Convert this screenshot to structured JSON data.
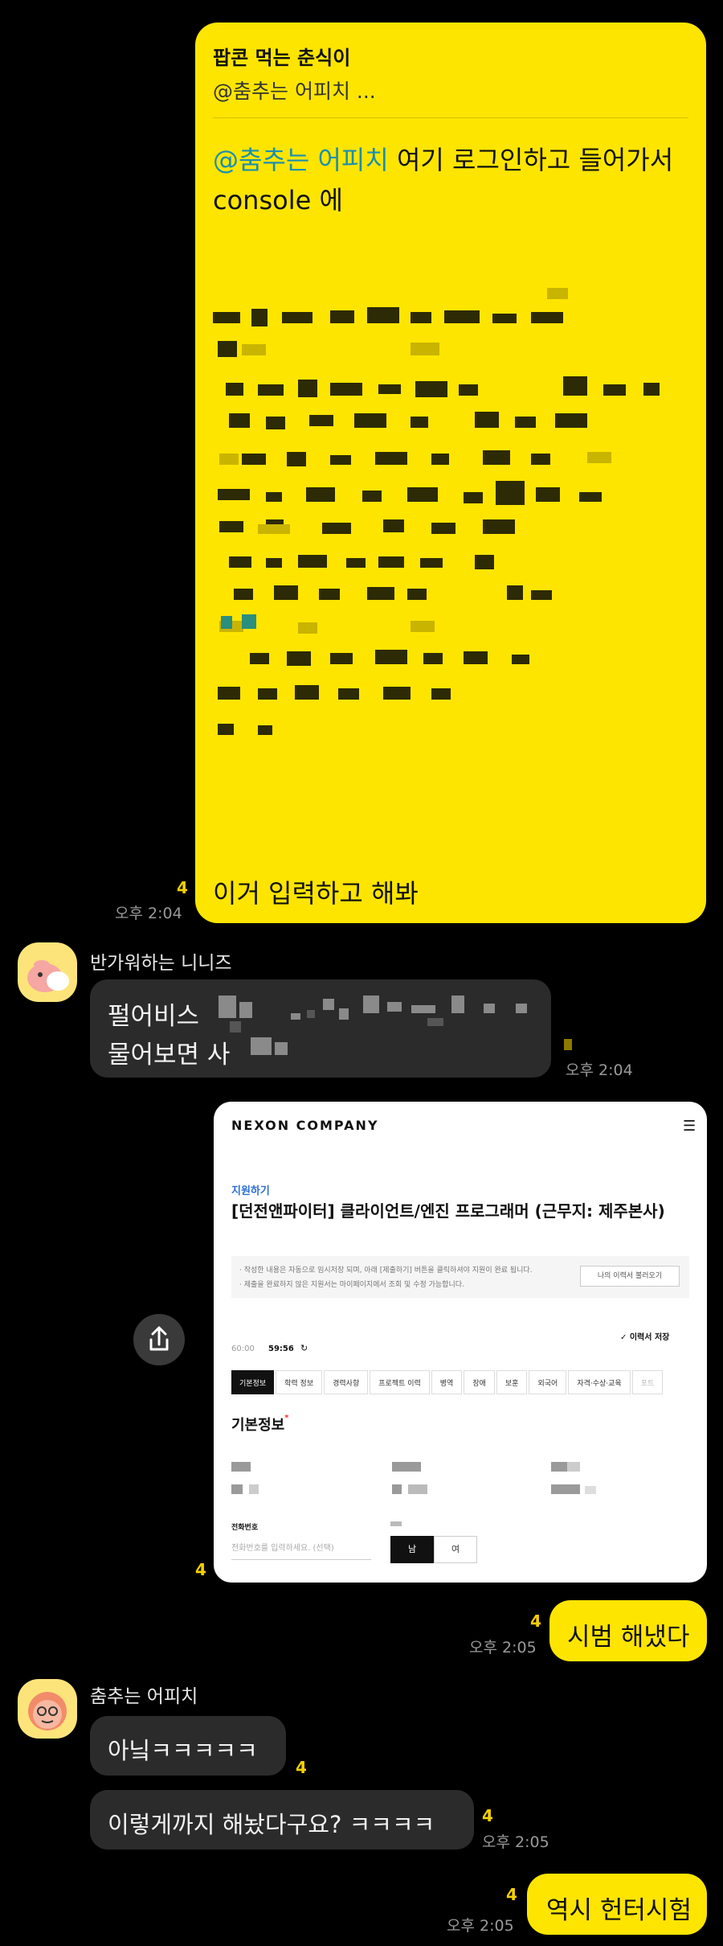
{
  "msg1": {
    "reply_name": "팝콘 먹는 춘식이",
    "reply_text": "@춤추는 어피치 ...",
    "mention": "@춤추는 어피치",
    "line1_rest": " 여기 로그인하고 들어가서",
    "line2": "console 에",
    "footer": "이거 입력하고 해봐",
    "count": "4",
    "time": "오후 2:04"
  },
  "msg2": {
    "sender": "반가워하는 니니즈",
    "line1": "펄어비스",
    "line2": "물어보면 사",
    "time": "오후 2:04"
  },
  "msg3": {
    "count": "4",
    "screenshot": {
      "logo": "NEXON COMPANY",
      "apply": "지원하기",
      "title": "[던전앤파이터] 클라이언트/엔진 프로그래머 (근무지: 제주본사)",
      "note1": "· 작성한 내용은 자동으로 임시저장 되며, 아래 [제출하기] 버튼을 클릭하셔야 지원이 완료 됩니다.",
      "note2": "· 제출을 완료하지 않은 지원서는 마이페이지에서 조회 및 수정 가능합니다.",
      "load_btn": "나의 이력서 불러오기",
      "save": "✓ 이력서 저장",
      "timer_a": "60:00",
      "timer_b": "59:56",
      "tabs": [
        "기본정보",
        "학력 정보",
        "경력사항",
        "프로젝트 이력",
        "병역",
        "장애",
        "보훈",
        "외국어",
        "자격·수상·교육",
        "포트"
      ],
      "section": "기본정보",
      "phone_label": "전화번호",
      "phone_placeholder": "전화번호를 입력하세요. (선택)",
      "male": "남",
      "female": "여"
    }
  },
  "msg4": {
    "text": "시범 해냈다",
    "count": "4",
    "time": "오후 2:05"
  },
  "msg5": {
    "sender": "춤추는 어피치",
    "text1": "아닠ㅋㅋㅋㅋㅋ",
    "count1": "4",
    "text2": "이렇게까지 해놨다구요? ㅋㅋㅋㅋ",
    "count2": "4",
    "time": "오후 2:05"
  },
  "msg6": {
    "text": "역시 헌터시험",
    "count": "4",
    "time": "오후 2:05"
  },
  "colors": {
    "bubble_yellow": "#fee500",
    "bubble_dark": "#2b2b2b",
    "mention": "#1a8fb0",
    "unread": "#f5d000"
  }
}
